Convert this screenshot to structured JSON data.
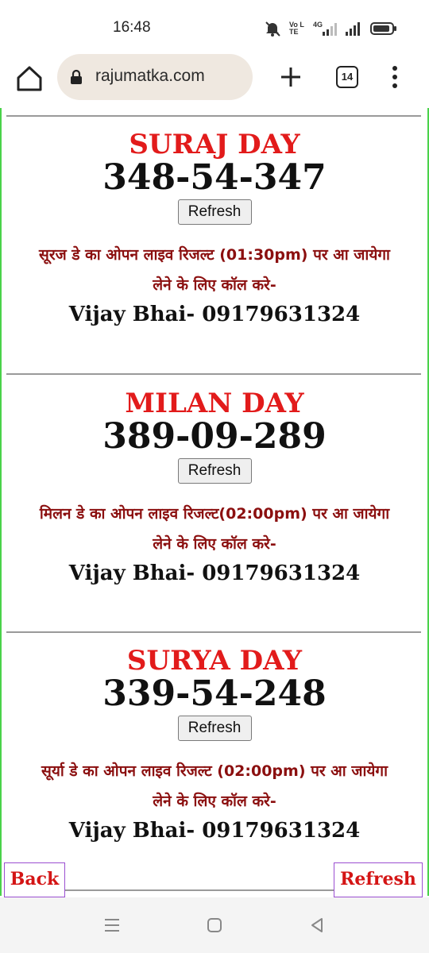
{
  "status_bar": {
    "time": "16:48",
    "icons": [
      "mute-icon",
      "volte-icon",
      "4g-signal-icon",
      "signal-icon",
      "battery-icon"
    ],
    "volte_label": "Vo LTE",
    "net_label": "4G"
  },
  "browser": {
    "url": "rajumatka.com",
    "tab_count": "14"
  },
  "games": [
    {
      "name": "SURAJ DAY",
      "result": "348-54-347",
      "refresh_label": "Refresh",
      "line1": "सूरज डे का ओपन लाइव रिजल्ट (01:30pm) पर आ जायेगा",
      "line2": "लेने के लिए कॉल करे-",
      "contact": "Vijay Bhai- 09179631324"
    },
    {
      "name": "MILAN DAY",
      "result": "389-09-289",
      "refresh_label": "Refresh",
      "line1": "मिलन डे का ओपन लाइव रिजल्ट(02:00pm) पर आ जायेगा",
      "line2": "लेने के लिए कॉल करे-",
      "contact": "Vijay Bhai- 09179631324"
    },
    {
      "name": "SURYA DAY",
      "result": "339-54-248",
      "refresh_label": "Refresh",
      "line1": "सूर्या डे का ओपन लाइव रिजल्ट (02:00pm) पर आ जायेगा",
      "line2": "लेने के लिए कॉल करे-",
      "contact": "Vijay Bhai- 09179631324"
    }
  ],
  "floating": {
    "back_label": "Back",
    "refresh_label": "Refresh"
  },
  "colors": {
    "title_red": "#e21b1b",
    "hindi_maroon": "#8b0f0f",
    "side_green": "#4ad24a",
    "button_border_purple": "#9b4fd1"
  }
}
